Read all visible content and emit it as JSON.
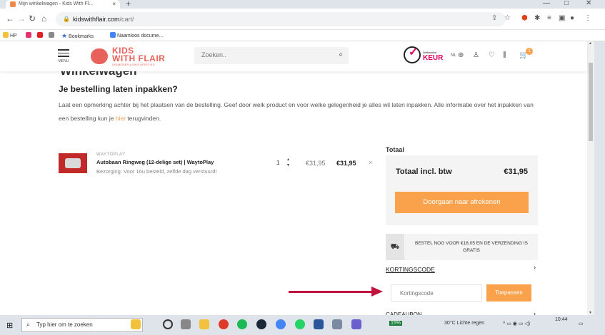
{
  "browser": {
    "tab_title": "Mijn winkelwagen - Kids With Fl...",
    "new_tab": "+",
    "close_tab": "×",
    "url_domain": "kidswithflair.com",
    "url_path": "/cart/",
    "win_min": "—",
    "win_max": "□",
    "win_close": "✕"
  },
  "bookmarks": [
    {
      "label": "HP",
      "color": "#f2c23c"
    },
    {
      "label": "",
      "color": "#e3326f"
    },
    {
      "label": "",
      "color": "#e02020"
    },
    {
      "label": "",
      "color": "#666"
    },
    {
      "label": "Bookmarks",
      "color": "#3a6fd8"
    },
    {
      "label": "Naamloos docume...",
      "color": "#4285f4"
    }
  ],
  "header": {
    "menu_label": "MENU",
    "logo_line1": "KIDS",
    "logo_line2": "WITH FLAIR",
    "logo_tagline": "GENIESSER & KIDS LIFESTYLE",
    "search_placeholder": "Zoeken..",
    "keur_small": "Webwinkel",
    "keur_big": "KEUR",
    "lang": "NL",
    "cart_count": "1"
  },
  "page": {
    "title": "Winkelwagen",
    "gift_title": "Je bestelling laten inpakken?",
    "gift_text_before": "Laat een opmerking achter bij het plaatsen van de bestelling. Geef door welk product en voor welke gelegenheid je alles wil laten inpakken. Alle informatie over het inpakken van een bestelling kun je ",
    "gift_link": "hier",
    "gift_text_after": " terugvinden."
  },
  "cart_item": {
    "brand": "WAYTOPLAY",
    "name": "Autobaan Ringweg (12-delige set) | WaytoPlay",
    "delivery": "Bezorging: Voor 16u besteld, zelfde dag verstuurd!",
    "qty": "1",
    "unit_price": "€31,95",
    "subtotal": "€31,95",
    "remove": "×"
  },
  "summary": {
    "label": "Totaal",
    "total_incl": "Totaal incl. btw",
    "total_value": "€31,95",
    "checkout": "Doorgaan naar afrekenen",
    "shipping_notice": "BESTEL NOG VOOR €18,05 EN DE VERZENDING IS GRATIS",
    "coupon_label": "KORTINGSCODE",
    "coupon_placeholder": "Kortingscode",
    "coupon_apply": "Toepassen",
    "giftcard_label": "CADEAUBON"
  },
  "taskbar": {
    "search_placeholder": "Typ hier om te zoeken",
    "weather": "30°C  Lichte regen",
    "time": "10:44",
    "battery": "15%"
  },
  "colors": {
    "accent": "#f9a24b",
    "logo": "#e8625b",
    "keur": "#e3005f",
    "arrow": "#c0143c"
  }
}
